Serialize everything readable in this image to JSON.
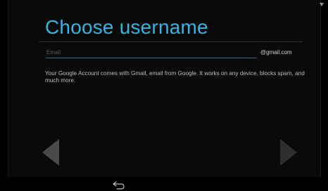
{
  "setup": {
    "title": "Choose username",
    "email_field": {
      "placeholder": "Email",
      "value": ""
    },
    "domain_suffix": "@gmail.com",
    "description": "Your Google Account comes with Gmail, email from Google. It works on any device, blocks spam, and much more."
  },
  "navigation": {
    "prev_icon": "chevron-left-icon",
    "next_icon": "chevron-right-icon",
    "back_icon": "back-arrow-icon"
  },
  "colors": {
    "accent": "#33b5e5",
    "background": "#000000",
    "arrow": "#4a4a4a",
    "arrow_disabled": "#2e2e2e"
  }
}
